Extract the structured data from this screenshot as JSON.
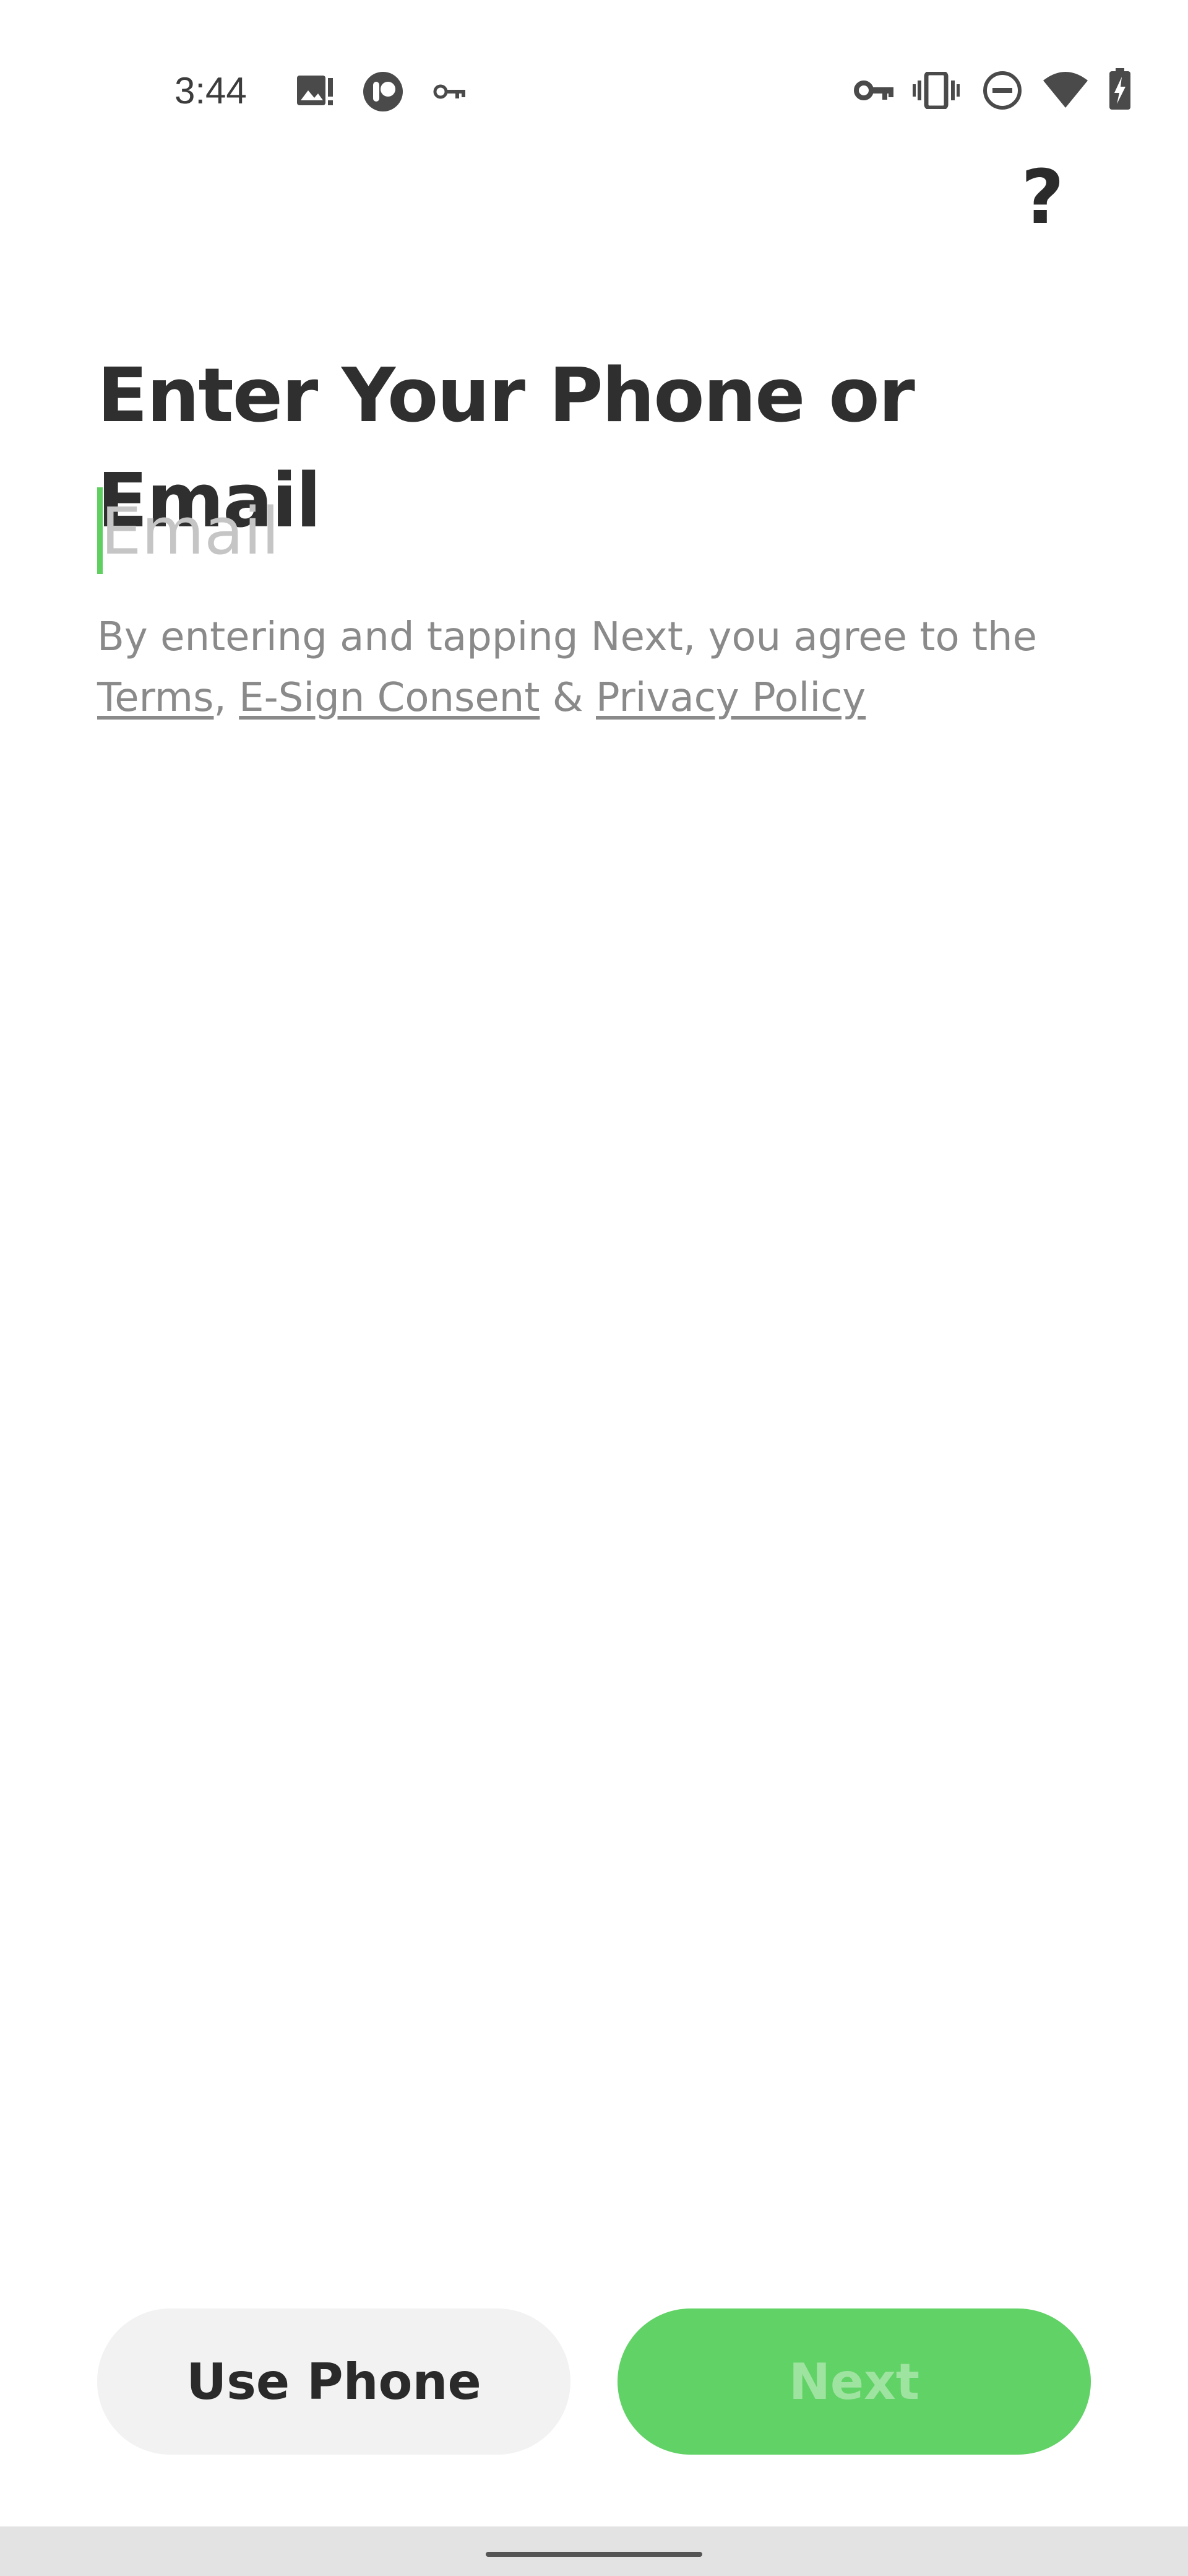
{
  "status_bar": {
    "time": "3:44",
    "left_icons": [
      "image-alert-icon",
      "app-circle-icon",
      "key-icon"
    ],
    "right_icons": [
      "vpn-key-icon",
      "vibrate-icon",
      "do-not-disturb-icon",
      "wifi-icon",
      "battery-charging-icon"
    ]
  },
  "header": {
    "help_label": "?"
  },
  "main": {
    "title": "Enter Your Phone or Email",
    "email_input": {
      "value": "",
      "placeholder": "Email"
    },
    "consent": {
      "prefix": "By entering and tapping Next, you agree to the",
      "terms_link": "Terms",
      "comma": ",",
      "esign_link": "E-Sign Consent",
      "ampersand": "&",
      "privacy_link": "Privacy Policy"
    }
  },
  "footer": {
    "use_phone_label": "Use Phone",
    "next_label": "Next",
    "next_color": "#61d265"
  }
}
